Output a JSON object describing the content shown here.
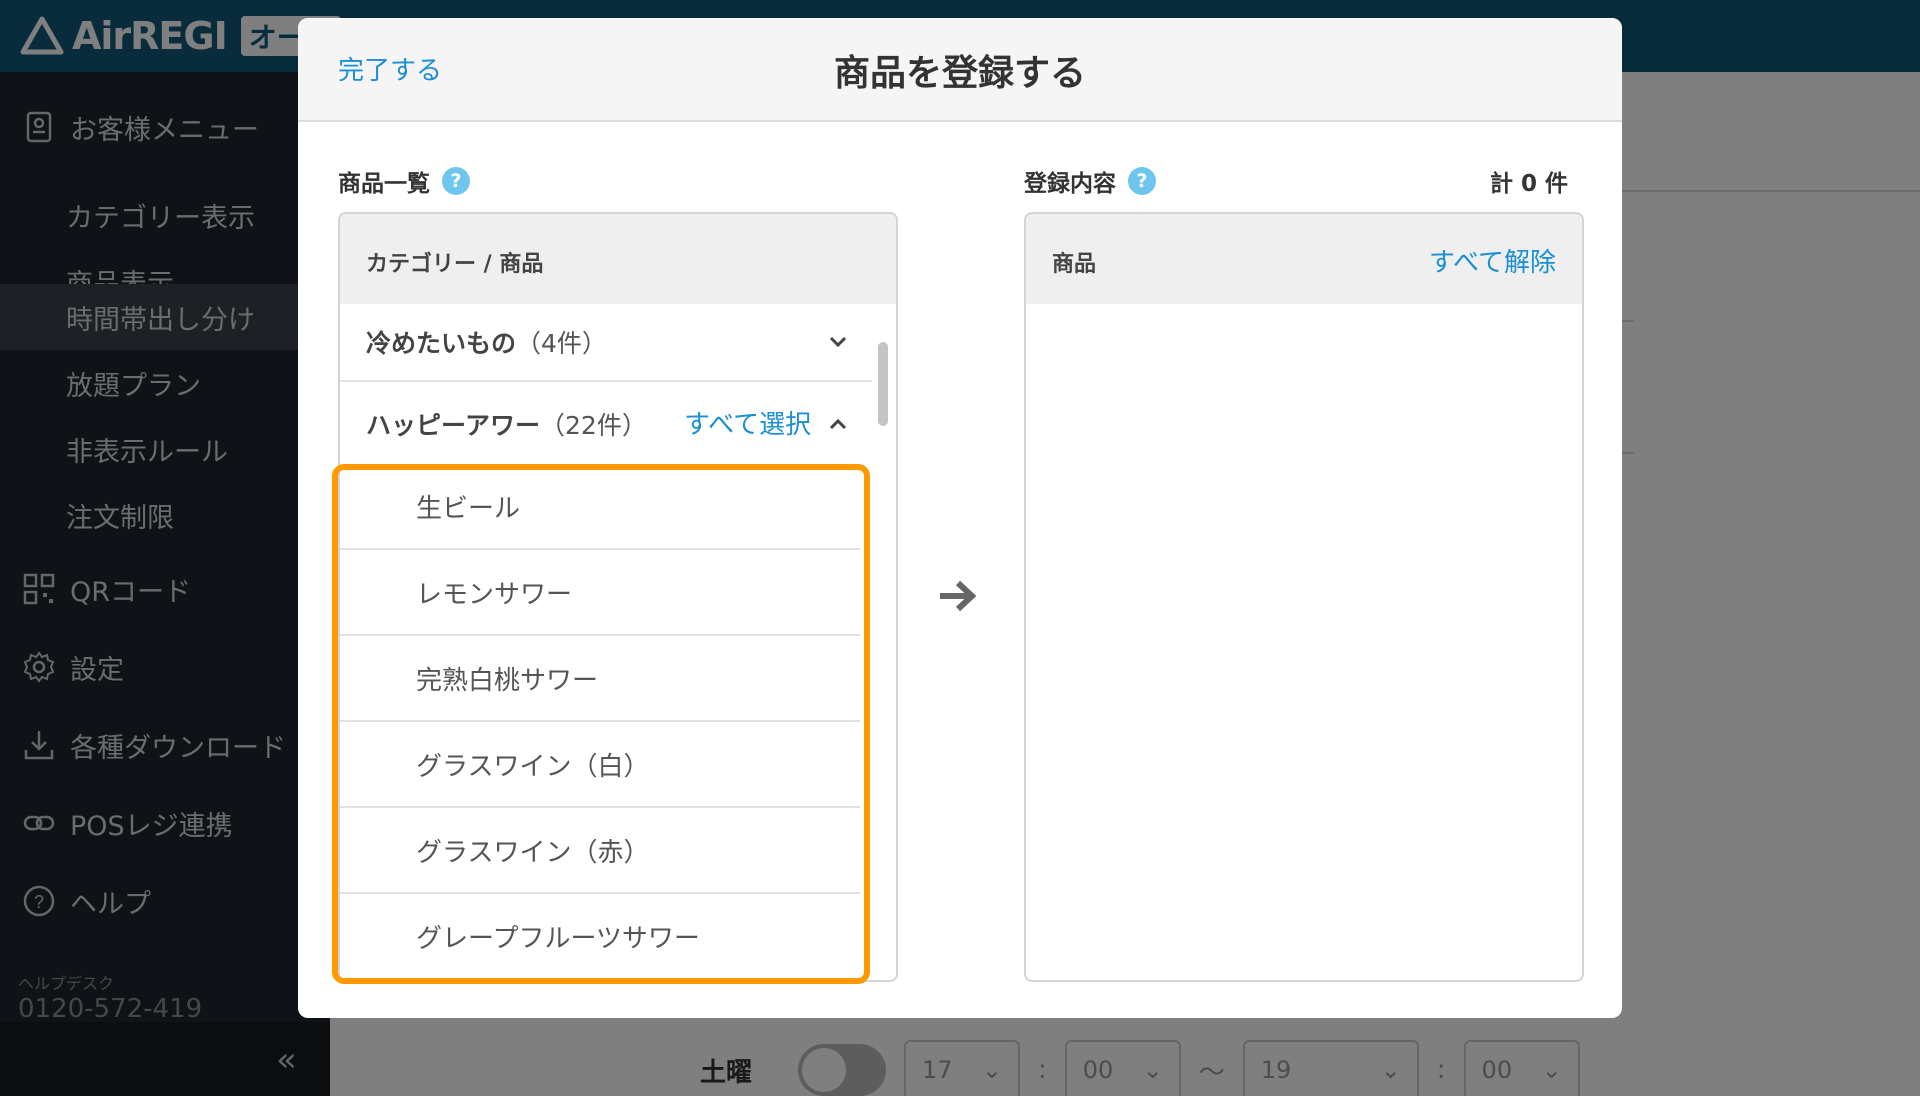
{
  "app": {
    "logo_text": "AirREGI",
    "logo_tag": "オーダ"
  },
  "sidebar": {
    "menu": {
      "label": "お客様メニュー",
      "icon": "menu-book-icon"
    },
    "sub_items": [
      {
        "label": "カテゴリー表示"
      },
      {
        "label": "商品表示"
      },
      {
        "label": "時間帯出し分け",
        "active": true
      },
      {
        "label": "放題プラン"
      },
      {
        "label": "非表示ルール"
      },
      {
        "label": "注文制限"
      }
    ],
    "items": [
      {
        "label": "QRコード",
        "icon": "qr-code-icon"
      },
      {
        "label": "設定",
        "icon": "gear-icon"
      },
      {
        "label": "各種ダウンロード",
        "icon": "download-icon"
      },
      {
        "label": "POSレジ連携",
        "icon": "link-icon"
      },
      {
        "label": "ヘルプ",
        "icon": "help-icon"
      }
    ],
    "helpdesk_label": "ヘルプデスク",
    "helpdesk_phone": "0120-572-419",
    "collapse_label": "«"
  },
  "background_row": {
    "day": "土曜",
    "start_hour": "17",
    "start_min": "00",
    "range_sep": "〜",
    "end_hour": "19",
    "end_min": "00",
    "colon": ":"
  },
  "modal": {
    "done_label": "完了する",
    "title": "商品を登録する",
    "arrow_icon": "arrow-right-icon",
    "left": {
      "section_label": "商品一覧",
      "help_glyph": "?",
      "header": "カテゴリー / 商品",
      "categories": [
        {
          "name": "冷めたいもの",
          "count": "（4件）",
          "expanded": false
        },
        {
          "name": "ハッピーアワー",
          "count": "（22件）",
          "expanded": true,
          "select_all": "すべて選択"
        }
      ],
      "items": [
        "生ビール",
        "レモンサワー",
        "完熟白桃サワー",
        "グラスワイン（白）",
        "グラスワイン（赤）",
        "グレープフルーツサワー"
      ]
    },
    "right": {
      "section_label": "登録内容",
      "help_glyph": "?",
      "count_label": "計 0 件",
      "header": "商品",
      "clear_all": "すべて解除"
    }
  },
  "colors": {
    "accent": "#1a8fd3",
    "highlight": "#ff9900",
    "topbar": "#13587a",
    "sidebar": "#1f252c"
  }
}
